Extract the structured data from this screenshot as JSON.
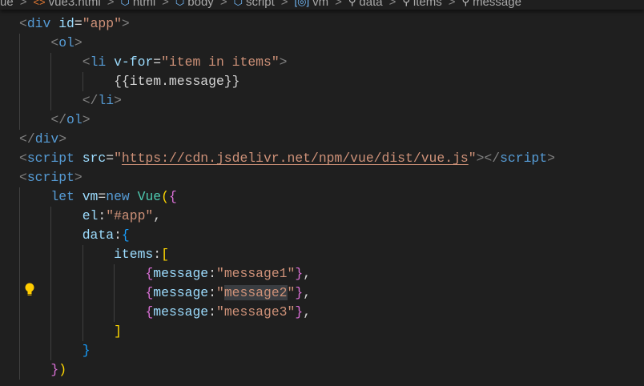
{
  "breadcrumb": [
    {
      "label": "ue",
      "icon": "folder-icon"
    },
    {
      "label": "vue3.html",
      "icon": "html-file-icon"
    },
    {
      "label": "html",
      "icon": "cube-icon"
    },
    {
      "label": "body",
      "icon": "cube-icon"
    },
    {
      "label": "script",
      "icon": "cube-icon"
    },
    {
      "label": "vm",
      "icon": "variable-icon"
    },
    {
      "label": "data",
      "icon": "wrench-icon"
    },
    {
      "label": "items",
      "icon": "wrench-icon"
    },
    {
      "label": "message",
      "icon": "wrench-icon"
    }
  ],
  "colors": {
    "background": "#1f1f1f",
    "tag": "#569cd6",
    "string": "#ce9178",
    "attribute": "#9cdcfe",
    "lightbulb": "#ffcc00"
  },
  "code_lines": [
    [
      [
        0,
        ""
      ],
      [
        "tag",
        "<"
      ],
      [
        "tn",
        "div"
      ],
      [
        "pl",
        " "
      ],
      [
        "at",
        "id"
      ],
      [
        "pl",
        "="
      ],
      [
        "str",
        "\"app\""
      ],
      [
        "tag",
        ">"
      ]
    ],
    [
      [
        1,
        ""
      ],
      [
        "tag",
        "<"
      ],
      [
        "tn",
        "ol"
      ],
      [
        "tag",
        ">"
      ]
    ],
    [
      [
        2,
        ""
      ],
      [
        "tag",
        "<"
      ],
      [
        "tn",
        "li"
      ],
      [
        "pl",
        " "
      ],
      [
        "at",
        "v-for"
      ],
      [
        "pl",
        "="
      ],
      [
        "str",
        "\"item in items\""
      ],
      [
        "tag",
        ">"
      ]
    ],
    [
      [
        3,
        ""
      ],
      [
        "pl",
        "{{item.message}}"
      ]
    ],
    [
      [
        2,
        ""
      ],
      [
        "tag",
        "</"
      ],
      [
        "tn",
        "li"
      ],
      [
        "tag",
        ">"
      ]
    ],
    [
      [
        1,
        ""
      ],
      [
        "tag",
        "</"
      ],
      [
        "tn",
        "ol"
      ],
      [
        "tag",
        ">"
      ]
    ],
    [
      [
        0,
        ""
      ],
      [
        "tag",
        "</"
      ],
      [
        "tn",
        "div"
      ],
      [
        "tag",
        ">"
      ]
    ],
    [
      [
        0,
        ""
      ],
      [
        "tag",
        "<"
      ],
      [
        "tn",
        "script"
      ],
      [
        "pl",
        " "
      ],
      [
        "at",
        "src"
      ],
      [
        "pl",
        "="
      ],
      [
        "str",
        "\""
      ],
      [
        "url",
        "https://cdn.jsdelivr.net/npm/vue/dist/vue.js"
      ],
      [
        "str",
        "\""
      ],
      [
        "tag",
        "></"
      ],
      [
        "tn",
        "script"
      ],
      [
        "tag",
        ">"
      ]
    ],
    [
      [
        0,
        ""
      ],
      [
        "tag",
        "<"
      ],
      [
        "tn",
        "script"
      ],
      [
        "tag",
        ">"
      ]
    ],
    [
      [
        1,
        ""
      ],
      [
        "kw",
        "let"
      ],
      [
        "pl",
        " "
      ],
      [
        "var",
        "vm"
      ],
      [
        "pl",
        "="
      ],
      [
        "kw",
        "new"
      ],
      [
        "pl",
        " "
      ],
      [
        "cls",
        "Vue"
      ],
      [
        "b1",
        "("
      ],
      [
        "b2",
        "{"
      ]
    ],
    [
      [
        2,
        ""
      ],
      [
        "var",
        "el"
      ],
      [
        "pl",
        ":"
      ],
      [
        "str",
        "\"#app\""
      ],
      [
        "pl",
        ","
      ]
    ],
    [
      [
        2,
        ""
      ],
      [
        "var",
        "data"
      ],
      [
        "pl",
        ":"
      ],
      [
        "b3",
        "{"
      ]
    ],
    [
      [
        3,
        ""
      ],
      [
        "var",
        "items"
      ],
      [
        "pl",
        ":"
      ],
      [
        "b1",
        "["
      ]
    ],
    [
      [
        4,
        ""
      ],
      [
        "b2",
        "{"
      ],
      [
        "var",
        "message"
      ],
      [
        "pl",
        ":"
      ],
      [
        "str",
        "\"message1\""
      ],
      [
        "b2",
        "}"
      ],
      [
        "pl",
        ","
      ]
    ],
    [
      [
        4,
        ""
      ],
      [
        "b2",
        "{"
      ],
      [
        "var",
        "message"
      ],
      [
        "pl",
        ":"
      ],
      [
        "str",
        "\""
      ],
      [
        "str sel",
        "message2"
      ],
      [
        "str",
        "\""
      ],
      [
        "b2",
        "}"
      ],
      [
        "pl",
        ","
      ]
    ],
    [
      [
        4,
        ""
      ],
      [
        "b2",
        "{"
      ],
      [
        "var",
        "message"
      ],
      [
        "pl",
        ":"
      ],
      [
        "str",
        "\"message3\""
      ],
      [
        "b2",
        "}"
      ],
      [
        "pl",
        ","
      ]
    ],
    [
      [
        3,
        ""
      ],
      [
        "b1",
        "]"
      ]
    ],
    [
      [
        2,
        ""
      ],
      [
        "b3",
        "}"
      ]
    ],
    [
      [
        1,
        ""
      ],
      [
        "b2",
        "}"
      ],
      [
        "b1",
        ")"
      ]
    ]
  ]
}
